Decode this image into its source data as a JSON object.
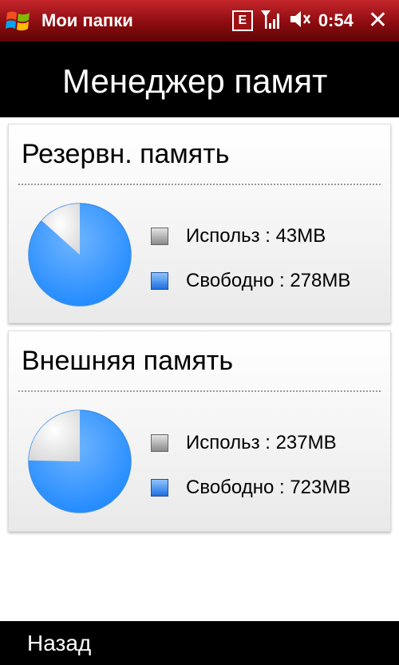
{
  "statusbar": {
    "app_title": "Мои папки",
    "network_badge": "E",
    "time": "0:54",
    "close_label": "✕",
    "icons": [
      "windows-start-icon",
      "signal-icon",
      "speaker-muted-icon",
      "close-icon"
    ]
  },
  "header": {
    "title": "Менеджер памят"
  },
  "cards": [
    {
      "title": "Резервн. память",
      "used_label": "Использ : 43MB",
      "free_label": "Свободно : 278MB",
      "used_mb": 43,
      "free_mb": 278
    },
    {
      "title": "Внешняя память",
      "used_label": "Использ : 237MB",
      "free_label": "Свободно : 723MB",
      "used_mb": 237,
      "free_mb": 723
    }
  ],
  "colors": {
    "statusbar": "#a5161b",
    "pie_free": "#1e88ff",
    "pie_used": "#ececec"
  },
  "bottombar": {
    "back_label": "Назад"
  }
}
